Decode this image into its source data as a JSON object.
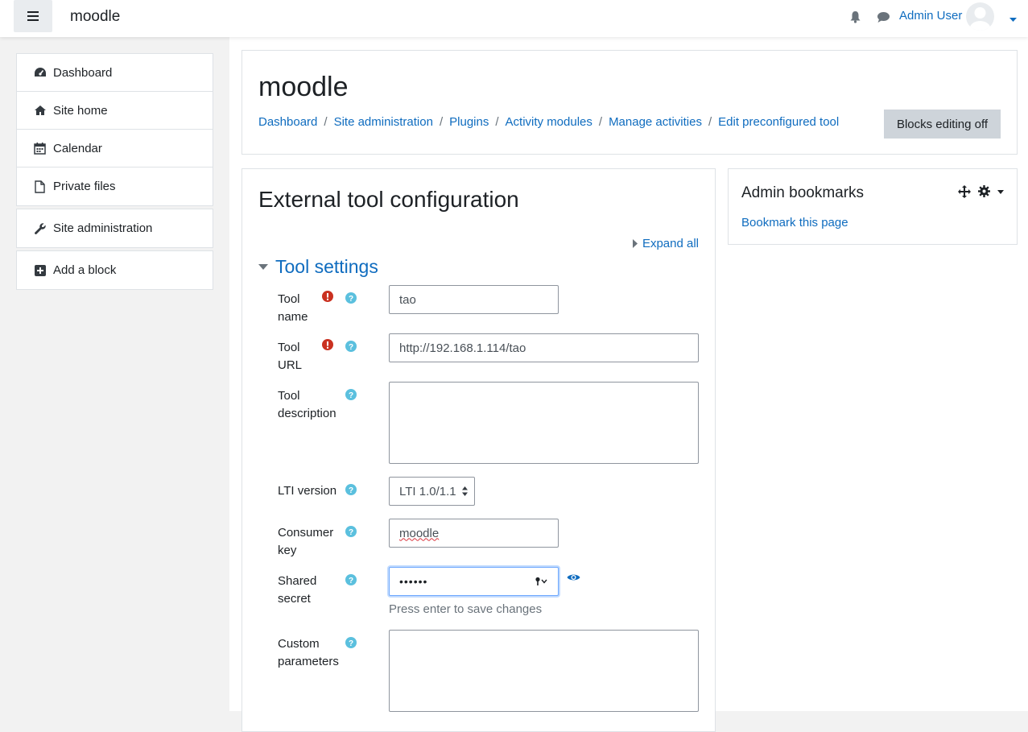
{
  "navbar": {
    "brand": "moodle",
    "user_name": "Admin User",
    "icons": [
      "menu-icon",
      "bell-icon",
      "chat-icon",
      "user-avatar",
      "caret-down-icon"
    ]
  },
  "sidebar": {
    "items": [
      {
        "label": "Dashboard",
        "icon": "dashboard-icon"
      },
      {
        "label": "Site home",
        "icon": "home-icon"
      },
      {
        "label": "Calendar",
        "icon": "calendar-icon"
      },
      {
        "label": "Private files",
        "icon": "file-icon"
      }
    ],
    "admin": {
      "label": "Site administration",
      "icon": "wrench-icon"
    },
    "add_block": {
      "label": "Add a block",
      "icon": "plus-square-icon"
    }
  },
  "header": {
    "title": "moodle",
    "breadcrumb": [
      "Dashboard",
      "Site administration",
      "Plugins",
      "Activity modules",
      "Manage activities",
      "Edit preconfigured tool"
    ],
    "blocks_button": "Blocks editing off"
  },
  "content": {
    "heading": "External tool configuration",
    "expand_all": "Expand all",
    "section_title": "Tool settings",
    "fields": {
      "tool_name": {
        "label_1": "Tool",
        "label_2": "name",
        "value": "tao"
      },
      "tool_url": {
        "label_1": "Tool",
        "label_2": "URL",
        "value": "http://192.168.1.114/tao"
      },
      "tool_description": {
        "label_1": "Tool",
        "label_2": "description",
        "value": ""
      },
      "lti_version": {
        "label": "LTI version",
        "value": "LTI 1.0/1.1"
      },
      "consumer_key": {
        "label_1": "Consumer",
        "label_2": "key",
        "value": "moodle"
      },
      "shared_secret": {
        "label_1": "Shared",
        "label_2": "secret",
        "value": "••••••",
        "hint": "Press enter to save changes"
      },
      "custom_parameters": {
        "label_1": "Custom",
        "label_2": "parameters",
        "value": ""
      }
    }
  },
  "block": {
    "title": "Admin bookmarks",
    "link": "Bookmark this page"
  },
  "colors": {
    "link": "#0f6cbf",
    "required": "#ca3120",
    "help": "#5bc0de"
  }
}
